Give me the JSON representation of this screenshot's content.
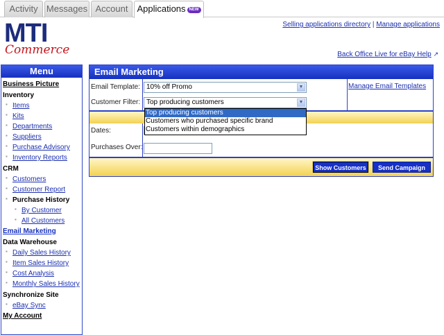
{
  "tabs": [
    {
      "label": "Activity",
      "active": false
    },
    {
      "label": "Messages",
      "active": false
    },
    {
      "label": "Account",
      "active": false
    },
    {
      "label": "Applications",
      "active": true,
      "badge": "NEW"
    }
  ],
  "logo": {
    "primary": "MTI",
    "secondary": "Commerce"
  },
  "header_links": {
    "selling_directory": "Selling applications directory",
    "separator": "|",
    "manage_apps": "Manage applications",
    "help": "Back Office Live for eBay Help"
  },
  "menu": {
    "title": "Menu",
    "items": [
      {
        "label": "Business Picture",
        "kind": "headlink"
      },
      {
        "label": "Inventory",
        "kind": "head"
      },
      {
        "label": "Items",
        "kind": "sub"
      },
      {
        "label": "Kits",
        "kind": "sub"
      },
      {
        "label": "Departments",
        "kind": "sub"
      },
      {
        "label": "Suppliers",
        "kind": "sub"
      },
      {
        "label": "Purchase Advisory",
        "kind": "sub"
      },
      {
        "label": "Inventory Reports",
        "kind": "sub"
      },
      {
        "label": "CRM",
        "kind": "head"
      },
      {
        "label": "Customers",
        "kind": "sub"
      },
      {
        "label": "Customer Report",
        "kind": "sub"
      },
      {
        "label": "Purchase History",
        "kind": "subhead"
      },
      {
        "label": "By Customer",
        "kind": "sub2"
      },
      {
        "label": "All Customers",
        "kind": "sub2"
      },
      {
        "label": "Email Marketing",
        "kind": "headlink-active"
      },
      {
        "label": "Data Warehouse",
        "kind": "head"
      },
      {
        "label": "Daily Sales History",
        "kind": "sub"
      },
      {
        "label": "Item Sales History",
        "kind": "sub"
      },
      {
        "label": "Cost Analysis",
        "kind": "sub"
      },
      {
        "label": "Monthly Sales History",
        "kind": "sub"
      },
      {
        "label": "Synchronize Site",
        "kind": "head"
      },
      {
        "label": "eBay Sync",
        "kind": "sub"
      },
      {
        "label": "My Account",
        "kind": "headlink"
      }
    ]
  },
  "email_marketing": {
    "title": "Email Marketing",
    "template_label": "Email Template:",
    "template_value": "10% off Promo",
    "manage_templates": "Manage Email Templates",
    "filter_label": "Customer Filter:",
    "filter_value": "Top producing customers",
    "filter_options": [
      "Top producing customers",
      "Customers who purchased specific brand",
      "Customers within demographics"
    ],
    "dates_label": "Dates:",
    "purchases_label": "Purchases Over:",
    "purchases_value": "",
    "show_button": "Show Customers",
    "send_button": "Send Campaign"
  },
  "colors": {
    "brand_blue": "#1630c0",
    "link_blue": "#1a2fb0",
    "logo_red": "#c4151c",
    "band_gold": "#f3d250"
  }
}
